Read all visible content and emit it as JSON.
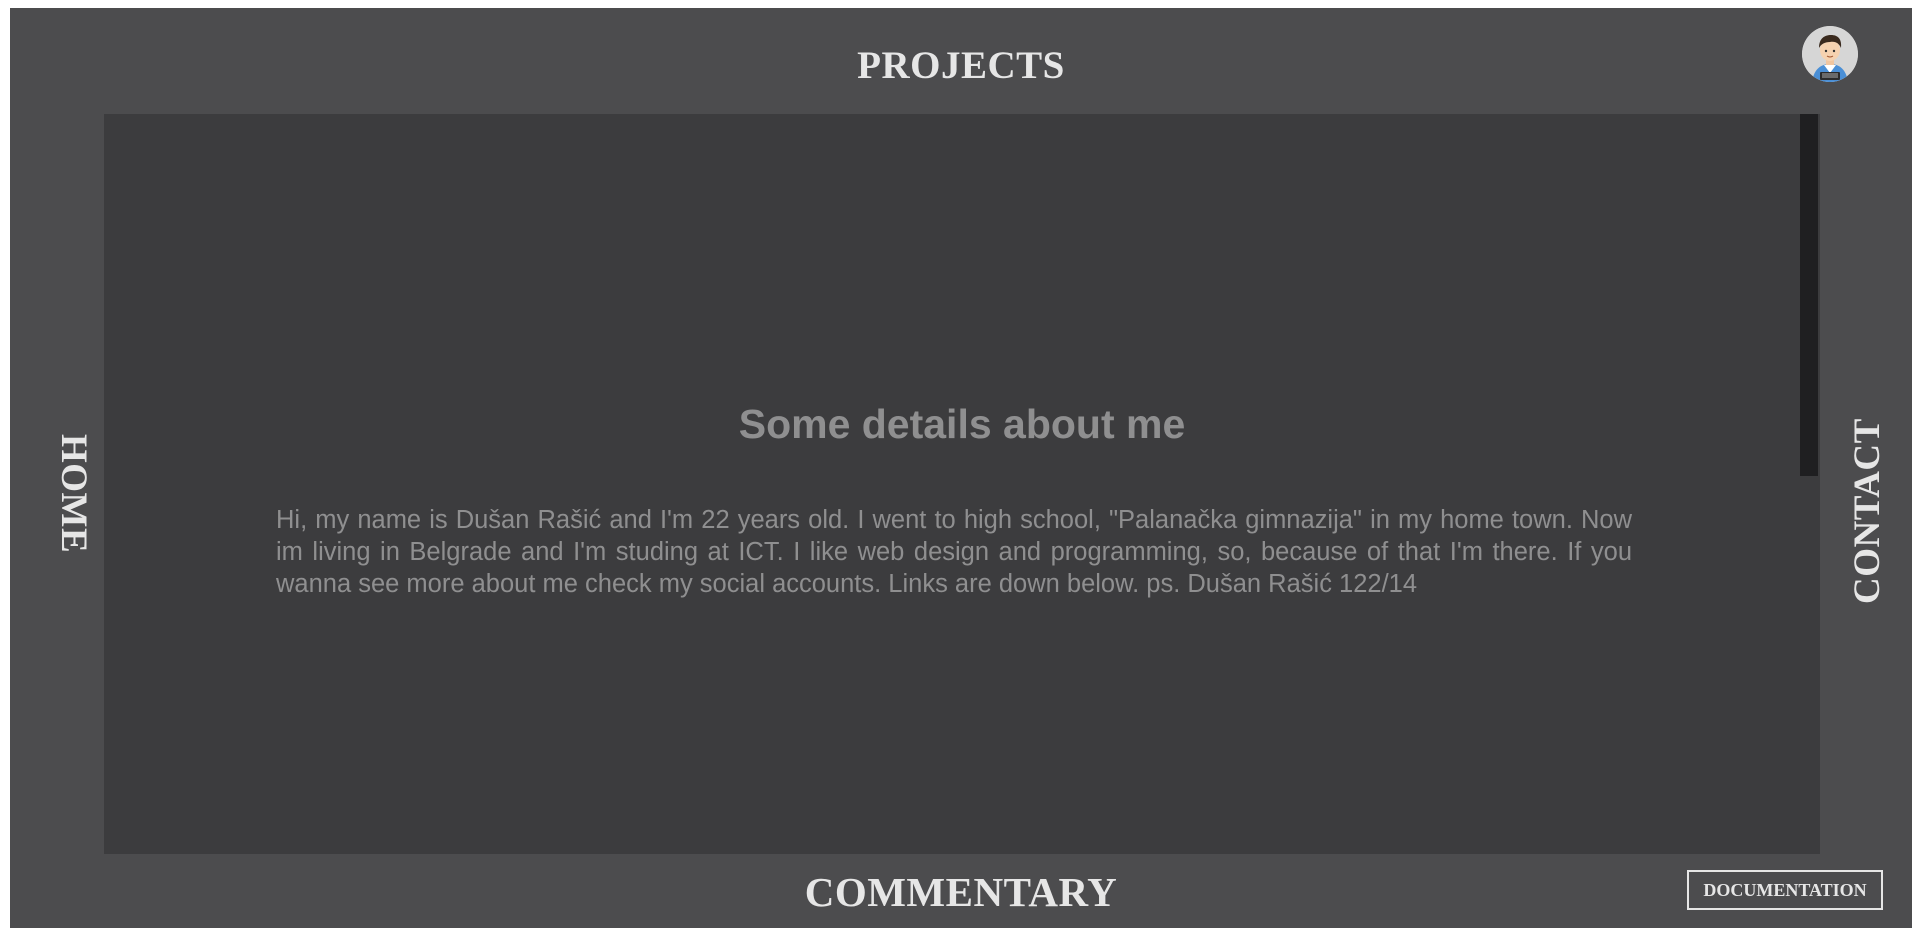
{
  "nav": {
    "top": "PROJECTS",
    "bottom": "COMMENTARY",
    "left": "HOME",
    "right": "CONTACT"
  },
  "content": {
    "title": "Some details about me",
    "body": "Hi, my name is Dušan Rašić and I'm 22 years old. I went to high school, \"Palanačka gimnazija\" in my home town. Now im living in Belgrade and I'm studing at ICT. I like web design and programming, so, because of that I'm there. If you wanna see more about me check my social accounts. Links are down below. ps. Dušan Rašić 122/14"
  },
  "footer": {
    "documentation_label": "DOCUMENTATION"
  },
  "icons": {
    "avatar": "user-avatar-icon"
  },
  "colors": {
    "frame_background": "#4c4c4e",
    "panel_background": "#3c3c3e",
    "nav_text": "#e6e6e6",
    "body_text": "#8f8f90",
    "scrollbar_thumb": "#1f1f21"
  }
}
